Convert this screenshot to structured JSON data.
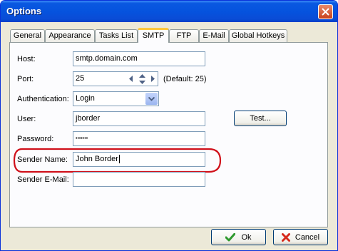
{
  "window": {
    "title": "Options"
  },
  "tabs": [
    {
      "label": "General",
      "active": false
    },
    {
      "label": "Appearance",
      "active": false
    },
    {
      "label": "Tasks List",
      "active": false
    },
    {
      "label": "SMTP",
      "active": true
    },
    {
      "label": "FTP",
      "active": false
    },
    {
      "label": "E-Mail",
      "active": false
    },
    {
      "label": "Global Hotkeys",
      "active": false
    }
  ],
  "smtp": {
    "host": {
      "label": "Host:",
      "value": "smtp.domain.com"
    },
    "port": {
      "label": "Port:",
      "value": "25",
      "default_note": "(Default: 25)"
    },
    "authentication": {
      "label": "Authentication:",
      "value": "Login"
    },
    "user": {
      "label": "User:",
      "value": "jborder"
    },
    "password": {
      "label": "Password:",
      "value": "•••••••"
    },
    "sender_name": {
      "label": "Sender Name:",
      "value": "John Border"
    },
    "sender_email": {
      "label": "Sender E-Mail:",
      "value": ""
    },
    "test_button": "Test..."
  },
  "footer": {
    "ok_label": "Ok",
    "cancel_label": "Cancel"
  },
  "colors": {
    "highlight": "#d0101a",
    "title_bar": "#0553de",
    "ok_check": "#2f9a2f",
    "cancel_x": "#d62a1c"
  }
}
